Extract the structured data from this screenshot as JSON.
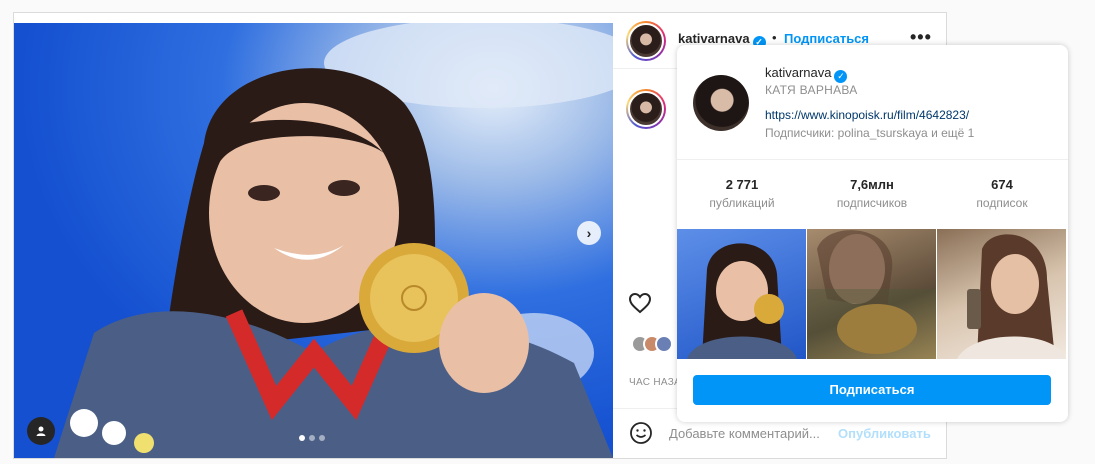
{
  "post": {
    "username": "kativarnava",
    "separator": "•",
    "follow_label": "Подписаться",
    "more_label": "•••",
    "time_label": "ЧАС НАЗАД",
    "comment_placeholder": "Добавьте комментарий...",
    "publish_label": "Опубликовать",
    "carousel": {
      "count": 3,
      "active": 1
    }
  },
  "popup": {
    "username": "kativarnava",
    "full_name": "КАТЯ ВАРНАВА",
    "link": "https://www.kinopoisk.ru/film/4642823/",
    "followers_text": "Подписчики: polina_tsurskaya и ещё 1",
    "stats": [
      {
        "value": "2 771",
        "label": "публикаций"
      },
      {
        "value": "7,6млн",
        "label": "подписчиков"
      },
      {
        "value": "674",
        "label": "подписок"
      }
    ],
    "follow_button": "Подписаться"
  },
  "icons": {
    "verified": "verified-badge-icon",
    "heart": "heart-icon",
    "next": "chevron-right-icon",
    "user_tag": "user-tag-icon",
    "emoji": "emoji-icon"
  },
  "colors": {
    "accent": "#0095f6",
    "link": "#00376b",
    "muted": "#8e8e8e",
    "publish_disabled": "#b2dffc"
  }
}
